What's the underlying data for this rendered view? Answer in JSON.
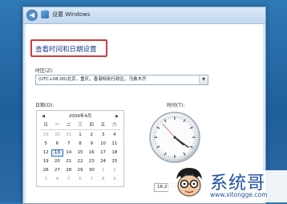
{
  "window": {
    "title": "设置 Windows"
  },
  "page": {
    "heading": "查看时间和日期设置"
  },
  "timezone": {
    "label": "时区(Z):",
    "value": "(UTC+08:00)北京，重庆，香港特别行政区，乌鲁木齐"
  },
  "date": {
    "label": "日期(D):",
    "month_title": "2009年4月",
    "weekdays": [
      "日",
      "一",
      "二",
      "三",
      "四",
      "五",
      "六"
    ],
    "days": [
      {
        "t": "29",
        "dim": true
      },
      {
        "t": "30",
        "dim": true
      },
      {
        "t": "31",
        "dim": true
      },
      {
        "t": "1"
      },
      {
        "t": "2"
      },
      {
        "t": "3"
      },
      {
        "t": "4"
      },
      {
        "t": "5"
      },
      {
        "t": "6"
      },
      {
        "t": "7"
      },
      {
        "t": "8"
      },
      {
        "t": "9"
      },
      {
        "t": "10"
      },
      {
        "t": "11"
      },
      {
        "t": "12"
      },
      {
        "t": "13",
        "sel": true
      },
      {
        "t": "14"
      },
      {
        "t": "15"
      },
      {
        "t": "16"
      },
      {
        "t": "17"
      },
      {
        "t": "18"
      },
      {
        "t": "19"
      },
      {
        "t": "20"
      },
      {
        "t": "21"
      },
      {
        "t": "22"
      },
      {
        "t": "23"
      },
      {
        "t": "24"
      },
      {
        "t": "25"
      },
      {
        "t": "26"
      },
      {
        "t": "27"
      },
      {
        "t": "28"
      },
      {
        "t": "29"
      },
      {
        "t": "30"
      },
      {
        "t": "1",
        "dim": true
      },
      {
        "t": "2",
        "dim": true
      },
      {
        "t": "3",
        "dim": true
      },
      {
        "t": "4",
        "dim": true
      },
      {
        "t": "5",
        "dim": true
      },
      {
        "t": "6",
        "dim": true
      },
      {
        "t": "7",
        "dim": true
      },
      {
        "t": "8",
        "dim": true
      },
      {
        "t": "9",
        "dim": true
      }
    ]
  },
  "time": {
    "label": "时间(T):",
    "value": "16:21:53"
  },
  "watermark": {
    "title": "系统哥",
    "url": "www.xitongge.com"
  },
  "colors": {
    "highlight_box": "#d33b3b",
    "heading_text": "#1f3f8a",
    "desktop_bg": "#2f79b6"
  }
}
